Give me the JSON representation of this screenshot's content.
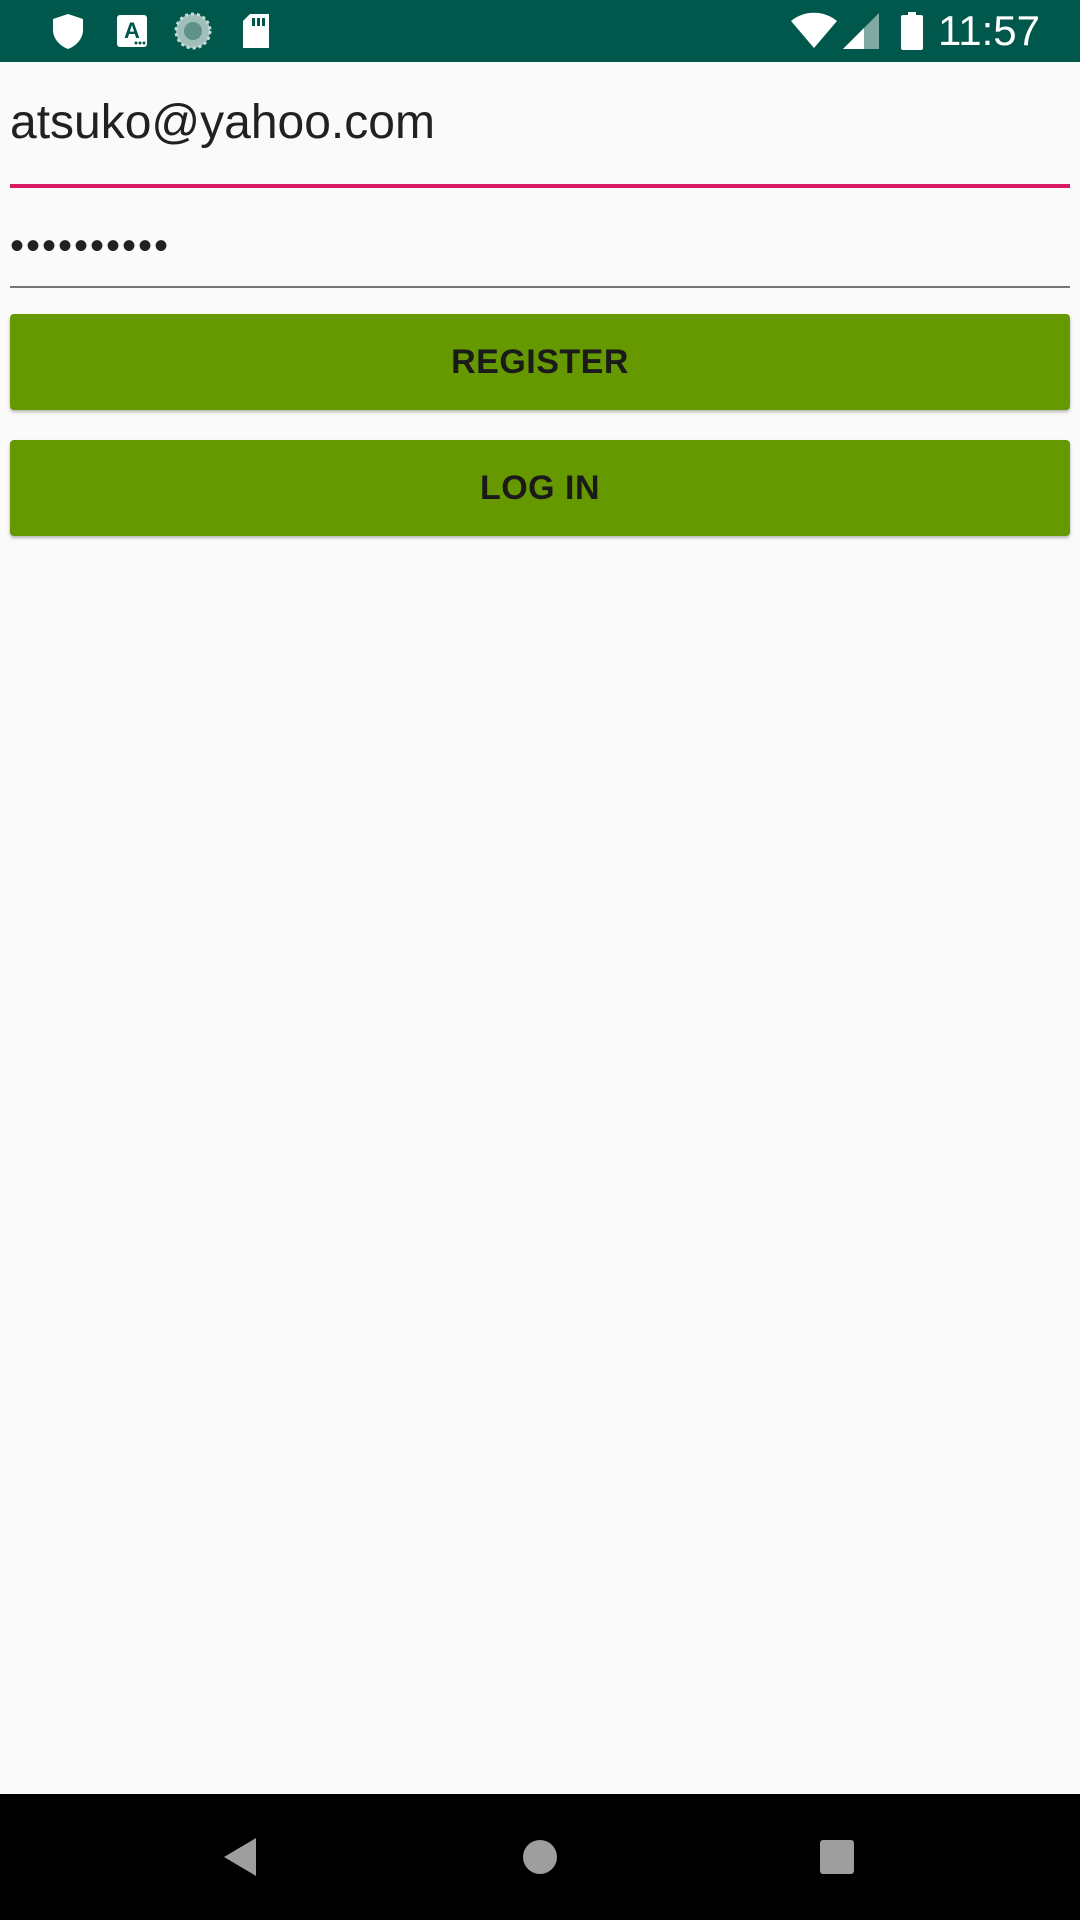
{
  "status_bar": {
    "time": "11:57",
    "left_icons": [
      "shield-icon",
      "text-a-icon",
      "sync-circle-icon",
      "sd-card-icon"
    ],
    "right_icons": [
      "wifi-icon",
      "cellular-signal-icon",
      "battery-icon"
    ],
    "background_color": "#00574b"
  },
  "form": {
    "email": {
      "value": "atsuko@yahoo.com",
      "underline_color": "#d81b60"
    },
    "password": {
      "value": "••••••••••",
      "underline_color": "#757575"
    },
    "register_label": "REGISTER",
    "login_label": "LOG IN",
    "button_color": "#669900"
  },
  "nav_bar": {
    "buttons": [
      "back-icon",
      "home-icon",
      "recents-icon"
    ]
  }
}
